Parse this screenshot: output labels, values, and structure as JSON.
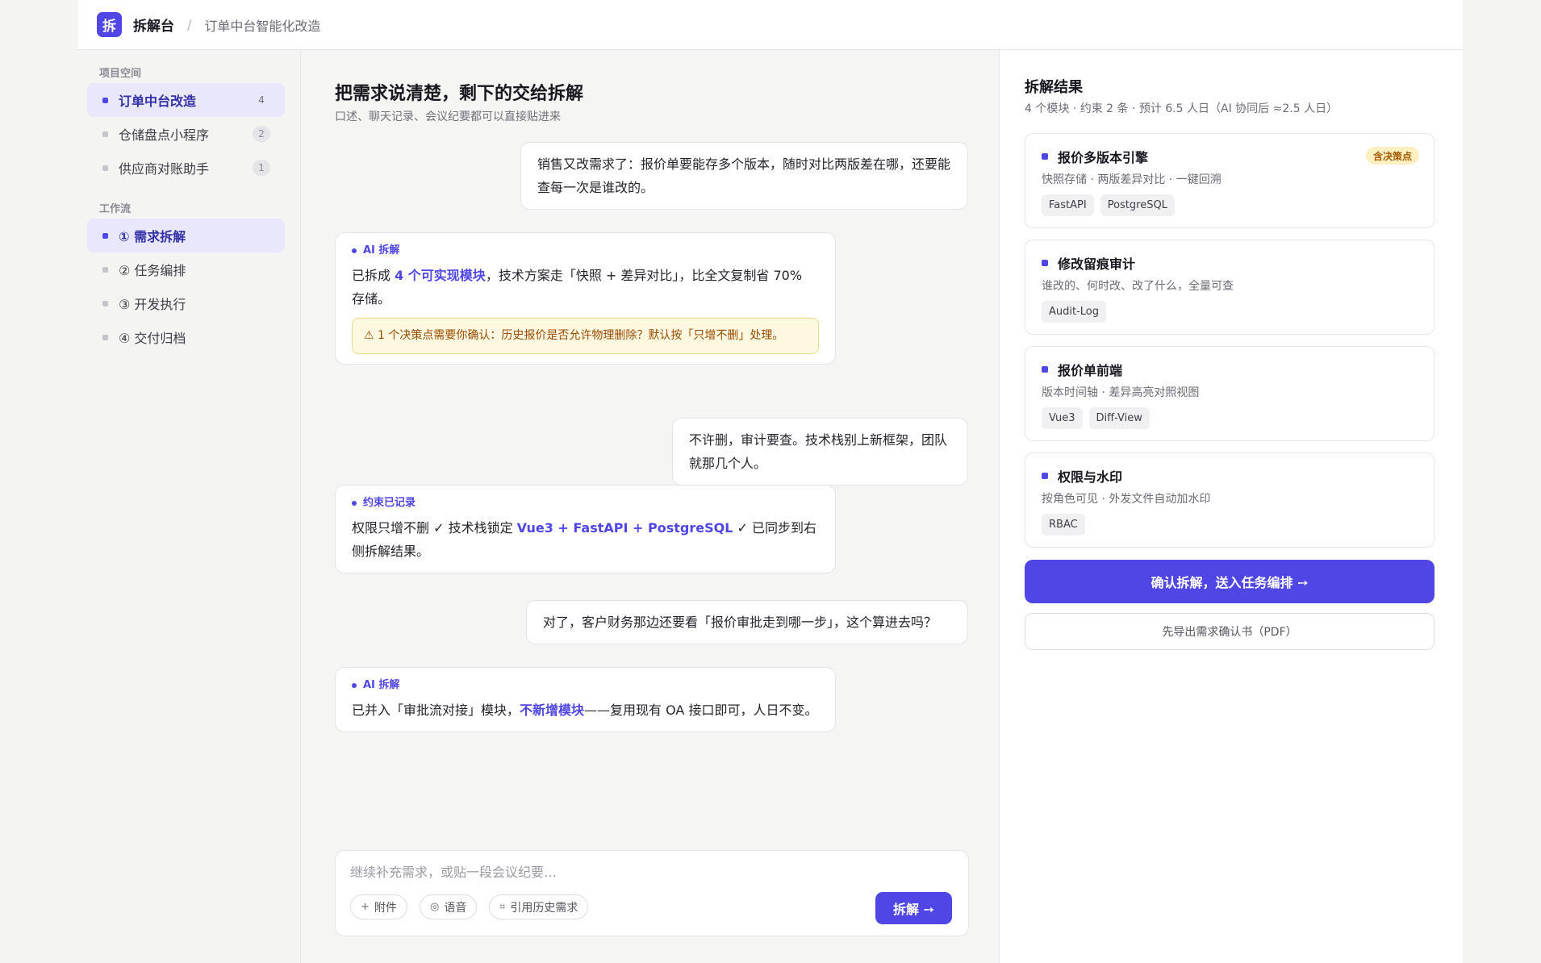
{
  "header": {
    "logo_char": "拆",
    "app_name": "拆解台",
    "separator": "/",
    "breadcrumb": "订单中台智能化改造"
  },
  "sidebar": {
    "projects_title": "项目空间",
    "projects": [
      {
        "label": "订单中台改造",
        "count": "4",
        "active": true
      },
      {
        "label": "仓储盘点小程序",
        "count": "2",
        "active": false
      },
      {
        "label": "供应商对账助手",
        "count": "1",
        "active": false
      }
    ],
    "workflow_title": "工作流",
    "workflow": [
      {
        "label": "① 需求拆解",
        "active": true
      },
      {
        "label": "② 任务编排",
        "active": false
      },
      {
        "label": "③ 开发执行",
        "active": false
      },
      {
        "label": "④ 交付归档",
        "active": false
      }
    ]
  },
  "chat": {
    "title": "把需求说清楚，剩下的交给拆解",
    "subtitle": "口述、聊天记录、会议纪要都可以直接贴进来",
    "messages": {
      "u1": "销售又改需求了：报价单要能存多个版本，随时对比两版差在哪，还要能查每一次是谁改的。",
      "a1": {
        "tag": "AI 拆解",
        "pre": "已拆成 ",
        "highlight": "4 个可实现模块",
        "post": "，技术方案走「快照 + 差异对比」，比全文复制省 70% 存储。",
        "warning": "⚠ 1 个决策点需要你确认：历史报价是否允许物理删除？默认按「只增不删」处理。"
      },
      "u2": "不许删，审计要查。技术栈别上新框架，团队就那几个人。",
      "a2": {
        "tag": "约束已记录",
        "pre": "权限只增不删 ✓  技术栈锁定 ",
        "highlight": "Vue3 + FastAPI + PostgreSQL",
        "post": " ✓  已同步到右侧拆解结果。"
      },
      "u3": "对了，客户财务那边还要看「报价审批走到哪一步」，这个算进去吗？",
      "a3": {
        "tag": "AI 拆解",
        "pre": "已并入「审批流对接」模块，",
        "highlight": "不新增模块",
        "post": "——复用现有 OA 接口即可，人日不变。"
      }
    },
    "composer": {
      "placeholder": "继续补充需求，或贴一段会议纪要…",
      "attach_icon": "+",
      "attach_label": "附件",
      "voice_icon": "◎",
      "voice_label": "语音",
      "history_icon": "⌗",
      "history_label": "引用历史需求",
      "send_label": "拆解 ➙"
    }
  },
  "results": {
    "title": "拆解结果",
    "summary": "4 个模块 · 约束 2 条 · 预计 6.5 人日（AI 协同后 ≈2.5 人日）",
    "modules": [
      {
        "name": "报价多版本引擎",
        "desc": "快照存储 · 两版差异对比 · 一键回溯",
        "tags": [
          "FastAPI",
          "PostgreSQL"
        ],
        "badge": "含决策点"
      },
      {
        "name": "修改留痕审计",
        "desc": "谁改的、何时改、改了什么，全量可查",
        "tags": [
          "Audit-Log"
        ]
      },
      {
        "name": "报价单前端",
        "desc": "版本时间轴 · 差异高亮对照视图",
        "tags": [
          "Vue3",
          "Diff-View"
        ]
      },
      {
        "name": "权限与水印",
        "desc": "按角色可见 · 外发文件自动加水印",
        "tags": [
          "RBAC"
        ]
      }
    ],
    "confirm_label": "确认拆解，送入任务编排 ➙",
    "export_label": "先导出需求确认书（PDF）"
  },
  "colors": {
    "accent": "#4f46e5",
    "warning_bg": "#fff8e0",
    "warning_text": "#9a4a00",
    "badge_bg": "#fff0c2"
  }
}
